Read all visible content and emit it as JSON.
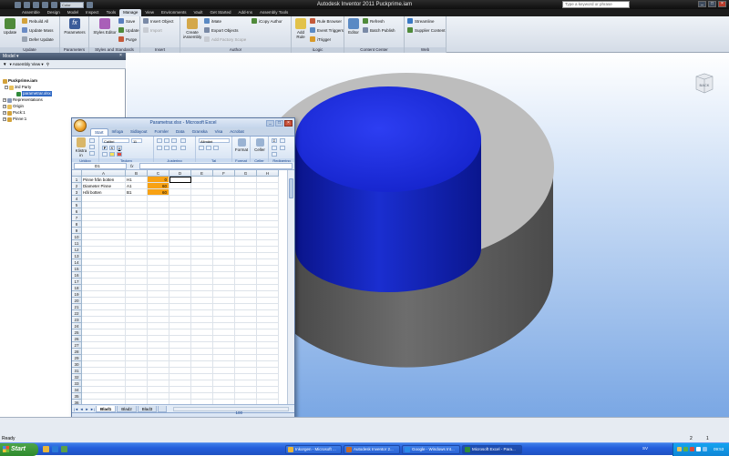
{
  "inventor": {
    "title": "Autodesk Inventor 2011    Puckprime.iam",
    "qat_combo": "Color",
    "search_placeholder": "Type a keyword or phrase",
    "tabs": [
      "Assemble",
      "Design",
      "Model",
      "Inspect",
      "Tools",
      "Manage",
      "View",
      "Environments",
      "Vault",
      "Get Started",
      "Add-Ins",
      "Assembly Tools"
    ],
    "active_tab": "Manage",
    "ribbon": {
      "update": {
        "label": "Update",
        "big": "Update",
        "items": [
          "Rebuild All",
          "Update Mass",
          "Defer Update"
        ]
      },
      "parameters": {
        "label": "Parameters",
        "big": "Parameters"
      },
      "styles": {
        "label": "Styles and Standards",
        "big": "Styles Editor",
        "items": [
          "Save",
          "Update",
          "Purge"
        ]
      },
      "insert": {
        "label": "Insert",
        "items": [
          "Insert Object",
          "Import"
        ]
      },
      "author": {
        "label": "Author",
        "big": "Create iAssembly",
        "items": [
          "iMate",
          "Export Objects",
          "Add Factory Scope"
        ],
        "extra": "iCopy Author"
      },
      "ilogic": {
        "label": "iLogic",
        "big": "Add Rule",
        "items": [
          "Rule Browser",
          "Event Triggers",
          "iTrigger"
        ]
      },
      "content": {
        "label": "Content Center",
        "big": "Editor",
        "items": [
          "Refresh",
          "Batch Publish"
        ]
      },
      "web": {
        "label": "Web",
        "items": [
          "Streamline",
          "Supplier Content"
        ]
      }
    }
  },
  "browser": {
    "title": "Model",
    "tool_label": "Assembly View",
    "tree": [
      {
        "label": "Puckprime.iam",
        "bold": true
      },
      {
        "label": "3rd Party"
      },
      {
        "label": "parametrar.xlsx",
        "selected": true
      },
      {
        "label": "Representations"
      },
      {
        "label": "Origin"
      },
      {
        "label": "Puck:1"
      },
      {
        "label": "Pinne:1"
      }
    ]
  },
  "excel": {
    "title": "Parametrar.xlsx - Microsoft Excel",
    "tabs": [
      "Start",
      "Infoga",
      "Sidlayout",
      "Formler",
      "Data",
      "Granska",
      "Visa",
      "Acrobat"
    ],
    "active_tab": "Start",
    "groups": [
      "Urklipp",
      "Tecken",
      "Justering",
      "Tal",
      "Format",
      "Celler",
      "Redigering"
    ],
    "paste_label": "Klistra in",
    "font": "Calibri",
    "font_size": "11",
    "number_format": "Allmänt",
    "format_label": "Format",
    "cells_label": "Celler",
    "namebox": "D1",
    "fx": "fx",
    "columns": [
      "A",
      "B",
      "C",
      "D",
      "E",
      "F",
      "G",
      "H"
    ],
    "rows": [
      [
        "Pinne från botten",
        "H1",
        "0"
      ],
      [
        "Diameter Pinne",
        "A1",
        "60"
      ],
      [
        "Hål botten",
        "B1",
        "60"
      ]
    ],
    "row_count": 38,
    "sheets": [
      "Blad1",
      "Blad2",
      "Blad3"
    ],
    "active_sheet": "Blad1",
    "status": "Klar",
    "zoom": "100 %"
  },
  "status": {
    "text": "Ready",
    "numbers": [
      "2",
      "1"
    ]
  },
  "taskbar": {
    "start": "Start",
    "tasks": [
      {
        "label": "Inkorgen - Microsoft ...",
        "active": false
      },
      {
        "label": "Autodesk Inventor 2...",
        "active": false
      },
      {
        "label": "Google - Windows Int...",
        "active": false
      },
      {
        "label": "Microsoft Excel - Para...",
        "active": true
      }
    ],
    "lang": "SV",
    "clock": "09:53"
  },
  "colors": {
    "puck_top": "#1e2fe0",
    "puck_side": "#0a1aa8",
    "base_top": "#b9b9b9",
    "base_side": "#5f5f5f",
    "orange_cells": "#f8a214"
  }
}
